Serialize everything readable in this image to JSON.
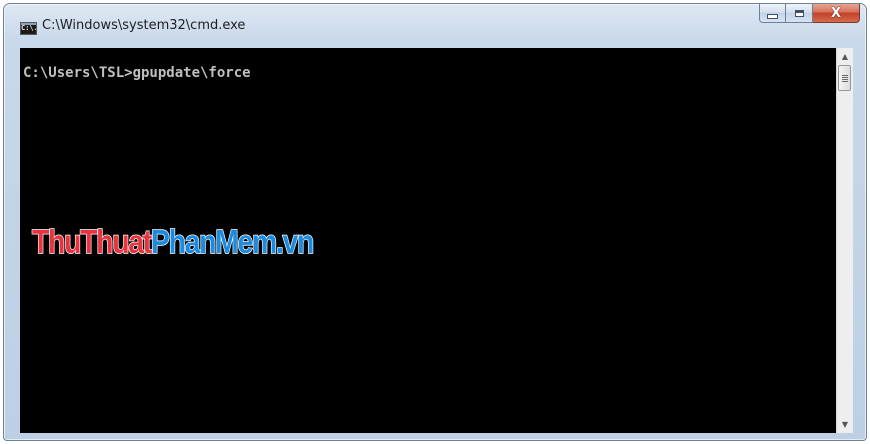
{
  "window": {
    "title": "C:\\Windows\\system32\\cmd.exe",
    "icon": "cmd-icon",
    "icon_text": "C:\\."
  },
  "caption_buttons": {
    "minimize": "minimize-icon",
    "maximize": "maximize-icon",
    "close_glyph": "X"
  },
  "console": {
    "lines": [
      "C:\\Users\\TSL>gpupdate\\force"
    ],
    "background": "#000000",
    "text_color": "#c0c0c0"
  },
  "watermark": {
    "part1": "ThuThuat",
    "part2": "PhanMem.vn",
    "color1": "#e8343f",
    "color2": "#1a8be0"
  },
  "scrollbar": {
    "up_arrow": "▲",
    "down_arrow": "▼"
  }
}
